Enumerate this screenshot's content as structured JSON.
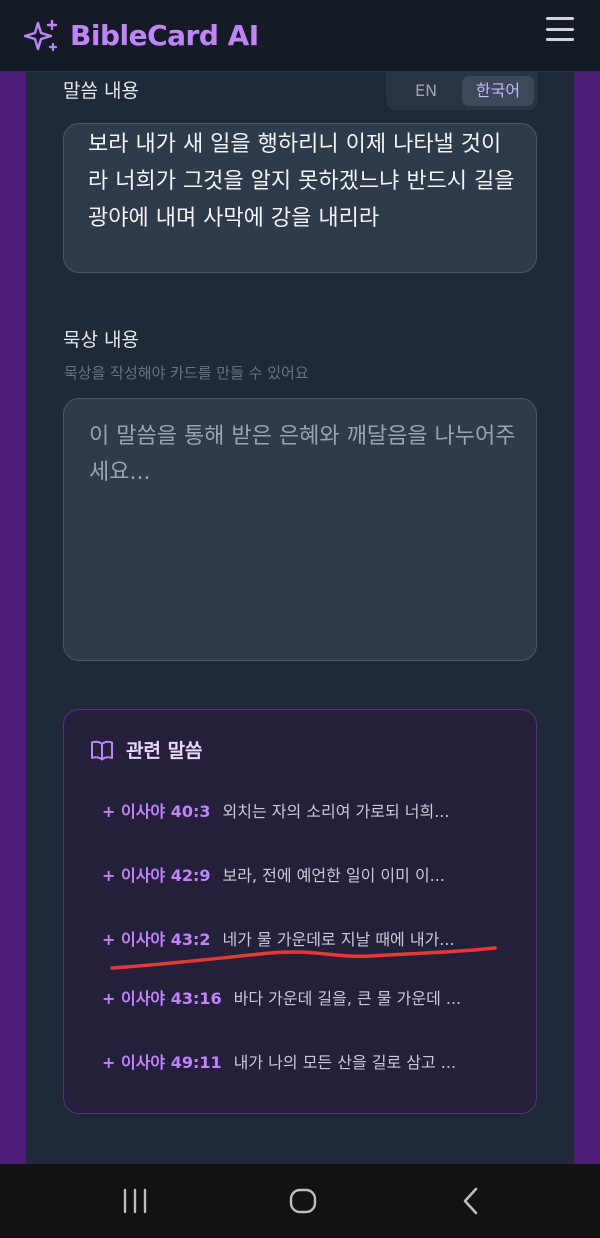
{
  "header": {
    "app_title": "BibleCard AI",
    "logo_icon": "sparkles-icon",
    "menu_icon": "hamburger-menu-icon",
    "accent": "#c084fc"
  },
  "verse": {
    "label": "말씀 내용",
    "language_options": [
      "EN",
      "한국어"
    ],
    "selected_language": "한국어",
    "text": "보라 내가 새 일을 행하리니 이제 나타낼 것이라 너희가 그것을 알지 못하겠느냐 반드시 길을 광야에 내며 사막에 강을 내리라"
  },
  "meditation": {
    "label": "묵상 내용",
    "helper": "묵상을 작성해야 카드를 만들 수 있어요",
    "placeholder": "이 말씀을 통해 받은 은혜와 깨달음을 나누어주세요...",
    "value": ""
  },
  "related": {
    "title": "관련 말씀",
    "icon": "open-book-icon",
    "items": [
      {
        "ref": "+ 이사야 40:3",
        "text": "외치는 자의 소리여 가로되 너희..."
      },
      {
        "ref": "+ 이사야 42:9",
        "text": "보라, 전에 예언한 일이 이미 이..."
      },
      {
        "ref": "+ 이사야 43:2",
        "text": "네가 물 가운데로 지날 때에 내가..."
      },
      {
        "ref": "+ 이사야 43:16",
        "text": "바다 가운데 길을, 큰 물 가운데 ..."
      },
      {
        "ref": "+ 이사야 49:11",
        "text": "내가 나의 모든 산을 길로 삼고 ..."
      }
    ]
  },
  "annotation": {
    "color": "#e53935"
  },
  "system_nav": {
    "icons": [
      "recent-apps-icon",
      "home-icon",
      "back-icon"
    ]
  }
}
